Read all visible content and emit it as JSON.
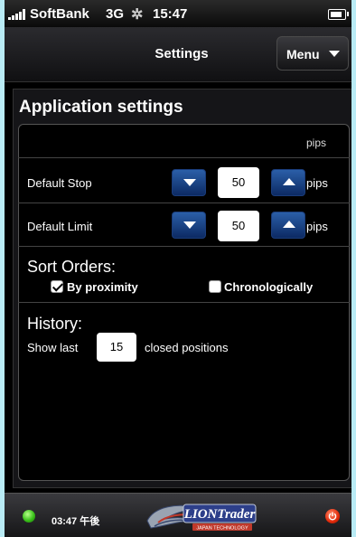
{
  "status_bar": {
    "carrier": "SoftBank",
    "network": "3G",
    "time": "15:47",
    "spinner_icon": "activity-spinner-icon",
    "battery_icon": "battery-icon"
  },
  "nav": {
    "title": "Settings",
    "menu_label": "Menu"
  },
  "section": {
    "title": "Application settings"
  },
  "table": {
    "pips_header": "pips",
    "rows": [
      {
        "label": "Default Stop",
        "value": "50",
        "unit": "pips"
      },
      {
        "label": "Default Limit",
        "value": "50",
        "unit": "pips"
      }
    ]
  },
  "sort": {
    "title": "Sort Orders:",
    "options": [
      {
        "label": "By proximity",
        "checked": true
      },
      {
        "label": "Chronologically",
        "checked": false
      }
    ]
  },
  "history": {
    "title": "History:",
    "prefix": "Show last",
    "value": "15",
    "suffix": "closed positions"
  },
  "footer": {
    "time": "03:47 午後",
    "logo_text": "LIONTrader",
    "logo_subtext": "JAPAN TECHNOLOGY",
    "status_color": "#39c11a",
    "power_color": "#e22a0a"
  }
}
